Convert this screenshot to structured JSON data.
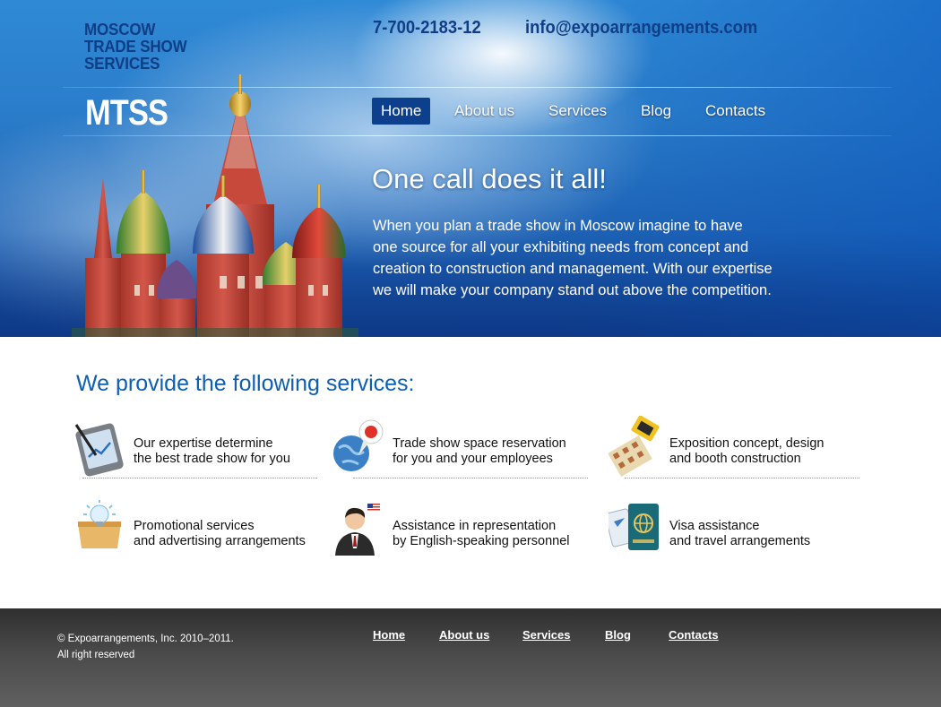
{
  "header": {
    "brand_text": "MOSCOW\nTRADE SHOW\nSERVICES",
    "logo": "MTSS",
    "phone": "7-700-2183-12",
    "email": "info@expoarrangements.com"
  },
  "nav": {
    "items": [
      {
        "label": "Home",
        "active": true
      },
      {
        "label": "About us",
        "active": false
      },
      {
        "label": "Services",
        "active": false
      },
      {
        "label": "Blog",
        "active": false
      },
      {
        "label": "Contacts",
        "active": false
      }
    ]
  },
  "hero": {
    "headline": "One call does it all!",
    "text": "When you plan a trade show in Moscow imagine to have\none source for all your exhibiting needs from concept and\ncreation to construction and management. With our expertise\nwe will make your company stand out above the competition.",
    "image": "saint-basils-cathedral"
  },
  "services": {
    "title": "We provide the following services:",
    "items": [
      {
        "text": "Our expertise determine\nthe best trade show for you",
        "icon": "tablet-chart-icon"
      },
      {
        "text": "Trade show space reservation\nfor you and your employees",
        "icon": "globe-pin-icon"
      },
      {
        "text": "Exposition concept, design\nand booth construction",
        "icon": "booth-design-icon"
      },
      {
        "text": "Promotional services\nand advertising arrangements",
        "icon": "idea-box-icon"
      },
      {
        "text": "Assistance in representation\nby English-speaking personnel",
        "icon": "businessman-icon"
      },
      {
        "text": "Visa assistance\nand travel arrangements",
        "icon": "passport-icon"
      }
    ]
  },
  "footer": {
    "copyright": "© Expoarrangements, Inc. 2010–2011.\nAll right reserved",
    "links": [
      "Home",
      "About us",
      "Services",
      "Blog",
      "Contacts"
    ]
  },
  "colors": {
    "brand_dark_blue": "#103e86",
    "title_blue": "#0d5fb4",
    "nav_active": "#0c3f8c",
    "footer_gray": "#4a4a4a"
  }
}
